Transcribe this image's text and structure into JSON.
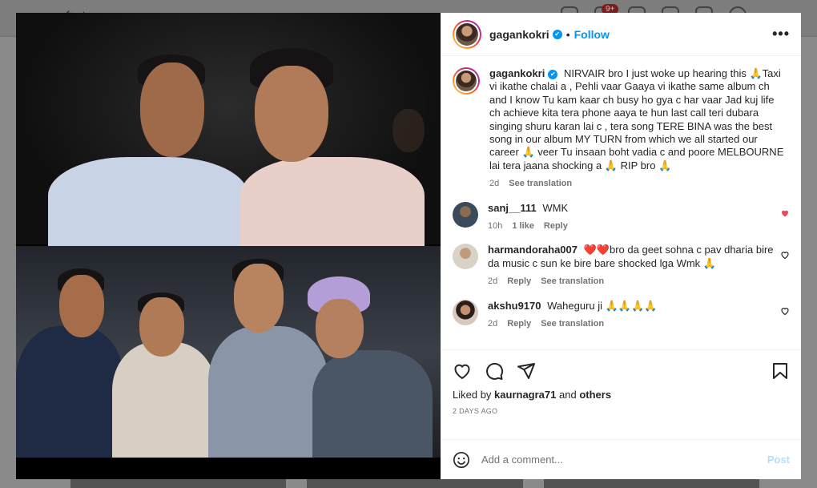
{
  "background": {
    "notification_count": "9+"
  },
  "post": {
    "author": "gagankokri",
    "follow_label": "Follow",
    "more_label": "•••",
    "caption": "NIRVAIR bro I just woke up hearing this 🙏Taxi vi ikathe chalai a , Pehli vaar Gaaya vi ikathe same album ch and I know Tu kam kaar ch busy ho gya c har vaar Jad kuj life ch achieve kita tera phone aaya te hun last call teri dubara singing shuru karan lai c , tera song TERE BINA was the best song in our album MY TURN from which we all started our career 🙏 veer Tu insaan boht vadia c and poore MELBOURNE lai tera jaana shocking a 🙏 RIP bro 🙏",
    "caption_time": "2d",
    "see_translation": "See translation",
    "liked_by_prefix": "Liked by",
    "liked_by_user": "kaurnagra71",
    "liked_by_and": "and",
    "liked_by_others": "others",
    "date": "2 DAYS AGO"
  },
  "comments": [
    {
      "user": "sanj__111",
      "text": "WMK",
      "time": "10h",
      "likes": "1 like",
      "reply": "Reply",
      "liked": true
    },
    {
      "user": "harmandoraha007",
      "text": "❤️❤️bro da geet sohna c pav dharia bire da music c sun ke bire bare shocked lga Wmk 🙏",
      "time": "2d",
      "reply": "Reply",
      "translation": "See translation",
      "liked": false
    },
    {
      "user": "akshu9170",
      "text": "Waheguru ji 🙏🙏🙏🙏",
      "time": "2d",
      "reply": "Reply",
      "translation": "See translation",
      "liked": false
    }
  ],
  "composer": {
    "placeholder": "Add a comment...",
    "post_label": "Post"
  },
  "colors": {
    "accent": "#0095f6",
    "like_red": "#ed4956",
    "post_disabled": "#b2dffc"
  },
  "icons": [
    "heart-icon",
    "comment-icon",
    "share-icon",
    "bookmark-icon",
    "emoji-icon",
    "verified-icon",
    "more-icon"
  ]
}
